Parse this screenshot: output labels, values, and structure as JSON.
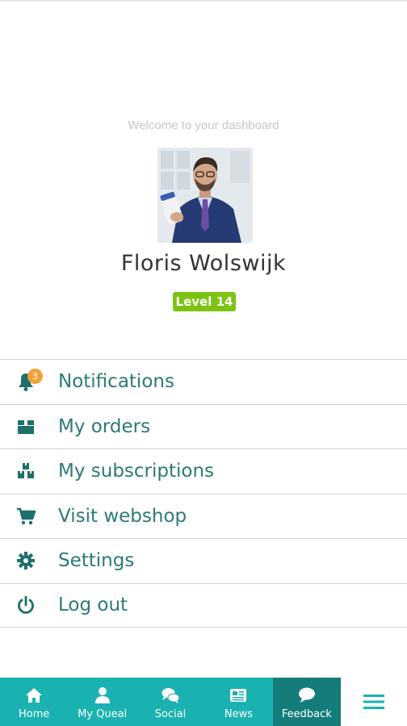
{
  "dashboard": {
    "welcome_text": "Welcome to your dashboard",
    "user_name": "Floris Wolswijk",
    "level_label": "Level 14"
  },
  "menu": {
    "items": [
      {
        "label": "Notifications",
        "icon": "bell-icon",
        "badge": "3"
      },
      {
        "label": "My orders",
        "icon": "box-icon"
      },
      {
        "label": "My subscriptions",
        "icon": "boxes-icon"
      },
      {
        "label": "Visit webshop",
        "icon": "cart-icon"
      },
      {
        "label": "Settings",
        "icon": "gear-icon"
      },
      {
        "label": "Log out",
        "icon": "power-icon"
      }
    ]
  },
  "bottom_nav": {
    "tabs": [
      {
        "label": "Home",
        "icon": "home-icon"
      },
      {
        "label": "My Queal",
        "icon": "user-icon"
      },
      {
        "label": "Social",
        "icon": "chat-bubbles-icon"
      },
      {
        "label": "News",
        "icon": "newspaper-icon"
      },
      {
        "label": "Feedback",
        "icon": "speech-bubble-icon",
        "active": true
      }
    ],
    "menu_icon": "hamburger-icon"
  },
  "colors": {
    "accent_teal": "#1ab2b0",
    "active_tab": "#147d7a",
    "menu_text": "#2b7a76",
    "level_badge": "#7cc314",
    "notification_badge": "#f0a23a"
  }
}
